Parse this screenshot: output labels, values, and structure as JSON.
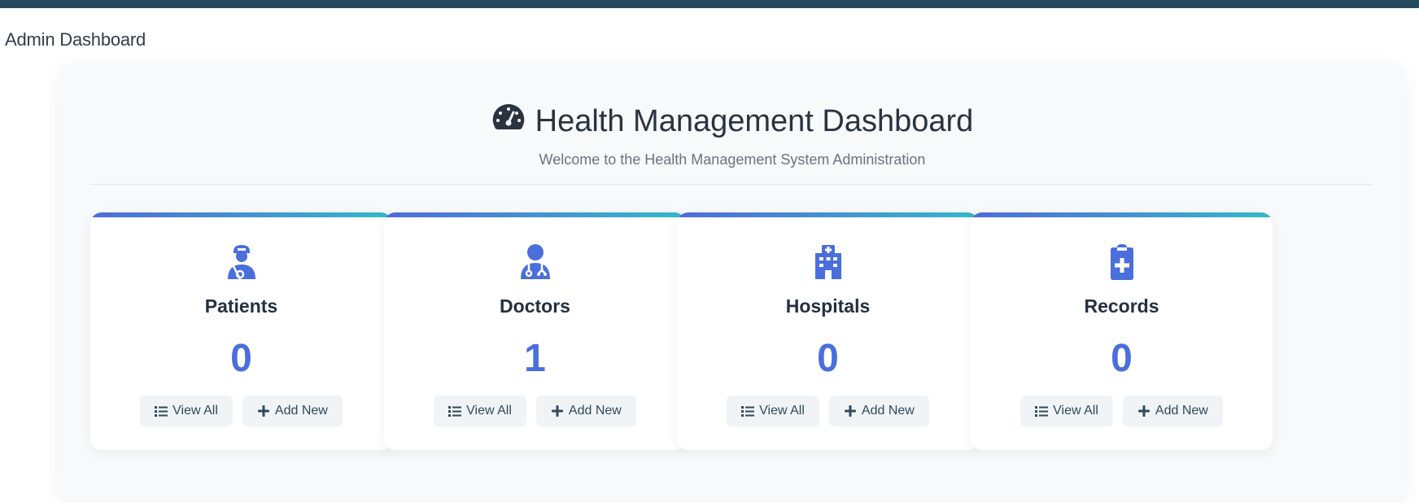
{
  "page": {
    "breadcrumb_title": "Admin Dashboard"
  },
  "header": {
    "icon": "tachometer-icon",
    "title": "Health Management Dashboard",
    "subtitle": "Welcome to the Health Management System Administration"
  },
  "colors": {
    "topbar": "#264a5e",
    "accent": "#4a6fdc",
    "gradient_start": "#4f6bdc",
    "gradient_end": "#35b8c8"
  },
  "cards": [
    {
      "icon": "patient-icon",
      "title": "Patients",
      "count": "0",
      "view_label": "View All",
      "add_label": "Add New"
    },
    {
      "icon": "doctor-icon",
      "title": "Doctors",
      "count": "1",
      "view_label": "View All",
      "add_label": "Add New"
    },
    {
      "icon": "hospital-icon",
      "title": "Hospitals",
      "count": "0",
      "view_label": "View All",
      "add_label": "Add New"
    },
    {
      "icon": "medical-record-icon",
      "title": "Records",
      "count": "0",
      "view_label": "View All",
      "add_label": "Add New"
    }
  ]
}
